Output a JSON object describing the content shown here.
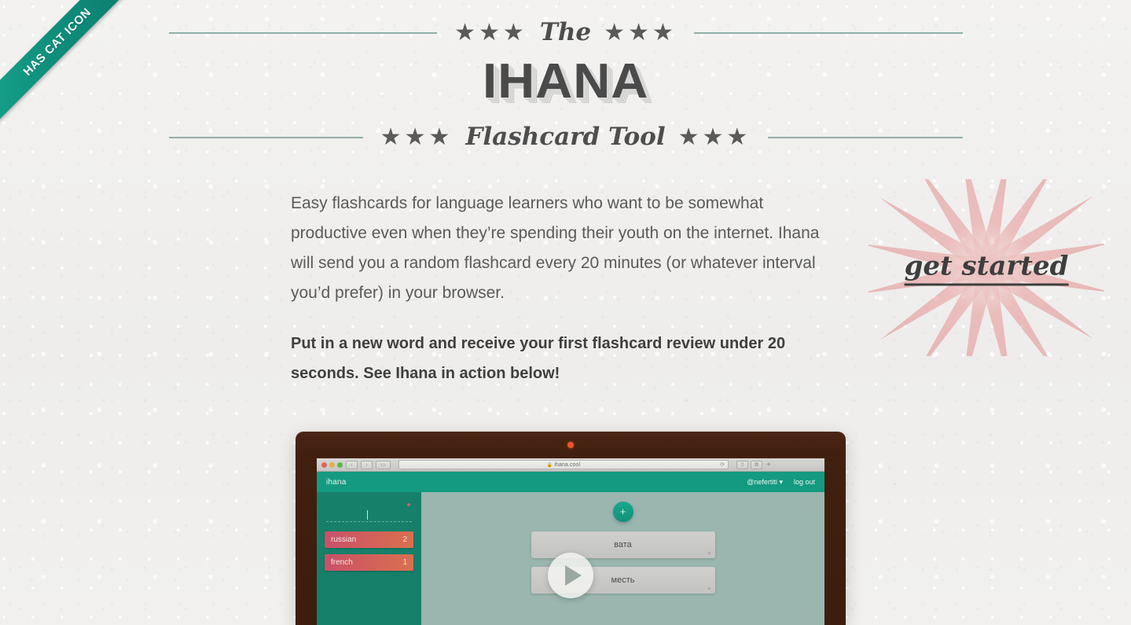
{
  "ribbon": {
    "label": "HAS CAT ICON",
    "color": "#0f8f7c"
  },
  "masthead": {
    "eyebrow_stars_left": "★★★",
    "eyebrow_word": "The",
    "eyebrow_stars_right": "★★★",
    "title": "IHANA",
    "subtitle_stars_left": "★★★",
    "subtitle_word": "Flashcard Tool",
    "subtitle_stars_right": "★★★",
    "rule_color": "#91b0a9"
  },
  "content": {
    "paragraph": "Easy flashcards for language learners who want to be somewhat productive even when they’re spending their youth on the internet. Ihana will send you a random flashcard every 20 minutes (or whatever interval you’d prefer) in your browser.",
    "paragraph_strong": "Put in a new word and receive your first flashcard review under 20 seconds. See Ihana in action below!"
  },
  "cta": {
    "label": "get started",
    "burst_color": "#e89696"
  },
  "demo": {
    "browser": {
      "url": "ihana.cool",
      "lock_icon": "lock-icon",
      "reload_icon": "reload-icon",
      "back_icon": "chevron-left-icon",
      "forward_icon": "chevron-right-icon",
      "sidebar_icon": "sidebar-toggle-icon",
      "share_icon": "share-icon",
      "tabs_icon": "tabs-icon",
      "newtab_label": "+"
    },
    "app": {
      "brand": "ihana",
      "user": "@nefertiti",
      "user_caret": "▾",
      "logout": "log out",
      "sidebar": {
        "filter_placeholder": "",
        "tags": [
          {
            "label": "russian",
            "count": "2"
          },
          {
            "label": "french",
            "count": "1"
          }
        ]
      },
      "workspace": {
        "add_label": "+",
        "cards": [
          {
            "text": "вата",
            "close": "×"
          },
          {
            "text": "месть",
            "close": "×"
          }
        ]
      }
    },
    "play_icon": "play-icon"
  }
}
